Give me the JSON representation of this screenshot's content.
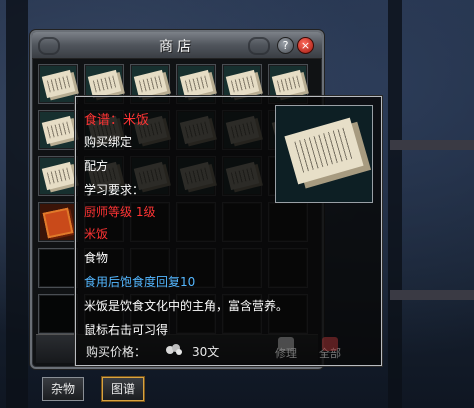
{
  "shop": {
    "title": "商店",
    "help_label": "?",
    "close_label": "×",
    "tabs": [
      {
        "label": "杂物",
        "active": false
      },
      {
        "label": "图谱",
        "active": true
      }
    ]
  },
  "tooltip": {
    "item_title": "食谱：米饭",
    "bind": "购买绑定",
    "type": "配方",
    "requirement_label": "学习要求：",
    "requirement_value": "厨师等级 1级",
    "product_name": "米饭",
    "product_type": "食物",
    "effect": "食用后饱食度回复10",
    "description": "米饭是饮食文化中的主角，富含营养。",
    "hint": "鼠标右击可习得",
    "price_label": "购买价格：",
    "price_value": "30文",
    "repair_label": "修理",
    "all_label": "全部",
    "item_icon": "recipe-scroll-icon"
  },
  "colors": {
    "red_text": "#ff3434",
    "blue_text": "#54b7ff",
    "accent_tab": "#d9a441"
  }
}
